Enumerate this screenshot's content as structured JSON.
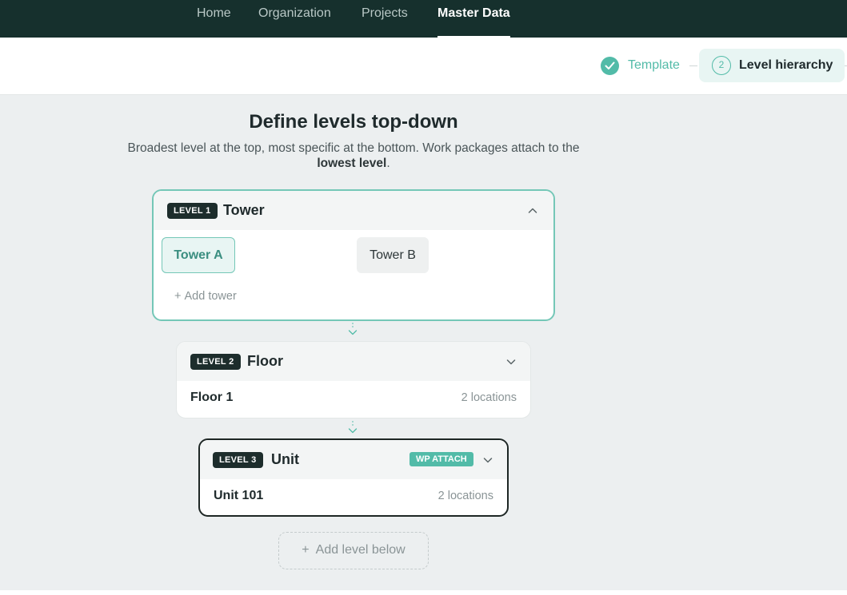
{
  "nav": {
    "items": [
      "Home",
      "Organization",
      "Projects",
      "Master Data"
    ]
  },
  "stepper": {
    "step1_label": "Template",
    "step2_number": "2",
    "step2_label": "Level hierarchy"
  },
  "page": {
    "title": "Define levels top-down",
    "subtitle_part1": "Broadest level at the top, most specific at the bottom. Work packages attach to the ",
    "subtitle_bold": "lowest level",
    "subtitle_end": "."
  },
  "levels": [
    {
      "badge": "LEVEL 1",
      "name": "Tower",
      "items": [
        "Tower A",
        "Tower B"
      ],
      "add_label": "Add tower"
    },
    {
      "badge": "LEVEL 2",
      "name": "Floor",
      "row_name": "Floor 1",
      "row_count": "2 locations"
    },
    {
      "badge": "LEVEL 3",
      "name": "Unit",
      "wp_badge": "WP ATTACH",
      "row_name": "Unit 101",
      "row_count": "2 locations"
    }
  ],
  "add_level_label": "Add level below",
  "colors": {
    "nav_bg": "#16302d",
    "accent": "#52bba8",
    "badge_dark": "#1d2d2c",
    "page_bg": "#eceff0"
  }
}
